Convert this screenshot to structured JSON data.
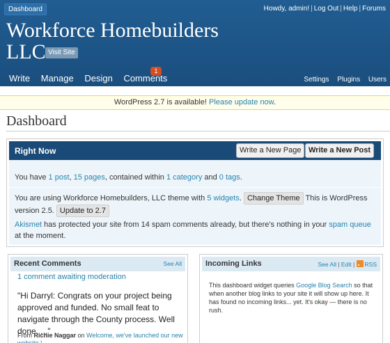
{
  "header": {
    "dashboard_tab": "Dashboard",
    "howdy": "Howdy, ",
    "username": "admin",
    "howdy_suffix": "!",
    "log_out": "Log Out",
    "help": "Help",
    "forums": "Forums",
    "site_title": "Workforce Homebuilders LLC",
    "visit_site": "Visit Site",
    "nav": [
      "Write",
      "Manage",
      "Design",
      "Comments"
    ],
    "comments_count": "1",
    "right_nav": [
      "Settings",
      "Plugins",
      "Users"
    ]
  },
  "notice": {
    "text": "WordPress 2.7 is available! ",
    "link": "Please update now",
    "end": "."
  },
  "page_title": "Dashboard",
  "right_now": {
    "title": "Right Now",
    "write_page": "Write a New Page",
    "write_post": "Write a New Post",
    "line1": {
      "a": "You have ",
      "posts": "1 post",
      "b": ", ",
      "pages": "15 pages",
      "c": ", contained within ",
      "categories": "1 category",
      "d": " and ",
      "tags": "0 tags",
      "e": "."
    },
    "line2": {
      "a": "You are using Workforce Homebuilders, LLC theme with ",
      "widgets": "5 widgets",
      "b": ". ",
      "change_theme": "Change Theme",
      "c": " This is WordPress version 2.5. ",
      "update": "Update to 2.7"
    },
    "line3": {
      "akismet": "Akismet",
      "a": " has protected your site from 14 spam comments already, but there's nothing in your ",
      "spam_queue": "spam queue",
      "b": " at the moment."
    }
  },
  "recent_comments": {
    "title": "Recent Comments",
    "see_all": "See All",
    "awaiting": "1 comment awaiting moderation",
    "quote": "\"Hi Darryl: Congrats on your project being approved and funded. No small feat to navigate through the County process. Well done. ...\"",
    "from": "From ",
    "author": "Richie Naggar",
    "on": " on ",
    "post": "Welcome, we've launched our new website !"
  },
  "incoming_links": {
    "title": "Incoming Links",
    "see_all": "See All",
    "edit": "Edit",
    "rss": "RSS",
    "text_a": "This dashboard widget queries ",
    "google": "Google Blog Search",
    "text_b": " so that when another blog links to your site it will show up here. It has found no incoming links... yet. It's okay — there is no rush."
  }
}
